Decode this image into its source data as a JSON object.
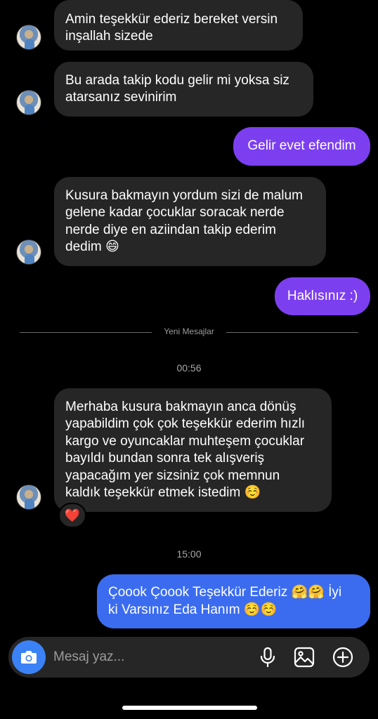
{
  "messages": [
    {
      "from": "them",
      "text": "Amin teşekkür ederiz bereket versin\ninşallah sizede"
    },
    {
      "from": "them",
      "text": "Bu arada takip kodu gelir mi yoksa siz\natarsanız sevinirim"
    },
    {
      "from": "me",
      "text": "Gelir evet efendim"
    },
    {
      "from": "them",
      "text": "Kusura bakmayın yordum sizi de malum\ngelene kadar çocuklar soracak nerde\nnerde diye en aziindan takip ederim\ndedim 😄"
    },
    {
      "from": "me",
      "text": "Haklısınız :)"
    },
    {
      "from": "them",
      "text": "Merhaba kusura bakmayın anca dönüş\nyapabildim çok çok teşekkür ederim hızlı\nkargo ve oyuncaklar muhteşem çocuklar\nbayıldı bundan sonra tek alışveriş\nyapacağım yer sizsiniz çok memnun\nkaldık teşekkür etmek istedim ☺️",
      "reaction": "❤️"
    },
    {
      "from": "me",
      "text": "Çoook Çoook Teşekkür Ederiz 🤗🤗 İyi\nki Varsınız Eda Hanım ☺️☺️"
    }
  ],
  "divider": {
    "label": "Yeni Mesajlar"
  },
  "timestamps": [
    "00:56",
    "15:00"
  ],
  "composer": {
    "placeholder": "Mesaj yaz..."
  },
  "icons": {
    "camera": "camera-icon",
    "mic": "microphone-icon",
    "gallery": "image-icon",
    "more": "plus-circle-icon"
  },
  "colors": {
    "incoming": "#262626",
    "outgoing_purple": "#7c3ff0",
    "outgoing_blue": "#3b6cf0",
    "camera_button": "#3b82f6"
  }
}
